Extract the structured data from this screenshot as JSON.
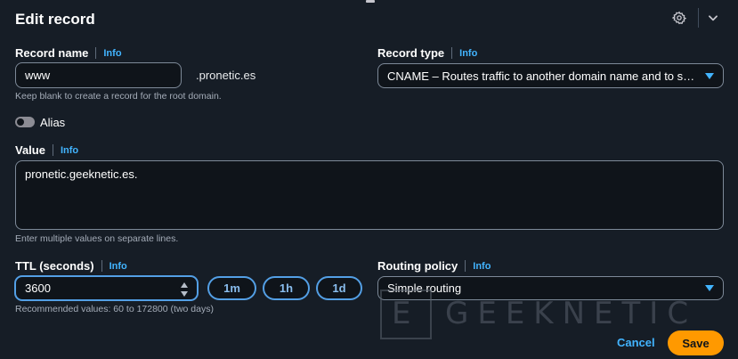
{
  "header": {
    "title": "Edit record",
    "settings_icon": "gear-icon",
    "collapse_icon": "chevron-down-icon"
  },
  "record_name": {
    "label": "Record name",
    "info": "Info",
    "value": "www",
    "suffix": ".pronetic.es",
    "hint": "Keep blank to create a record for the root domain."
  },
  "record_type": {
    "label": "Record type",
    "info": "Info",
    "selected": "CNAME – Routes traffic to another domain name and to some AWS resources"
  },
  "alias": {
    "label": "Alias",
    "enabled": false
  },
  "value_field": {
    "label": "Value",
    "info": "Info",
    "value": "pronetic.geeknetic.es.",
    "hint": "Enter multiple values on separate lines."
  },
  "ttl": {
    "label": "TTL (seconds)",
    "info": "Info",
    "value": "3600",
    "hint": "Recommended values: 60 to 172800 (two days)",
    "presets": [
      "1m",
      "1h",
      "1d"
    ]
  },
  "routing_policy": {
    "label": "Routing policy",
    "info": "Info",
    "selected": "Simple routing"
  },
  "watermark": {
    "letter": "E",
    "text": "GEEKNETIC"
  },
  "footer": {
    "cancel": "Cancel",
    "save": "Save"
  },
  "colors": {
    "background": "#161d26",
    "accent_link": "#42b4ff",
    "focus_border": "#539fe5",
    "primary_button": "#ff9900"
  }
}
